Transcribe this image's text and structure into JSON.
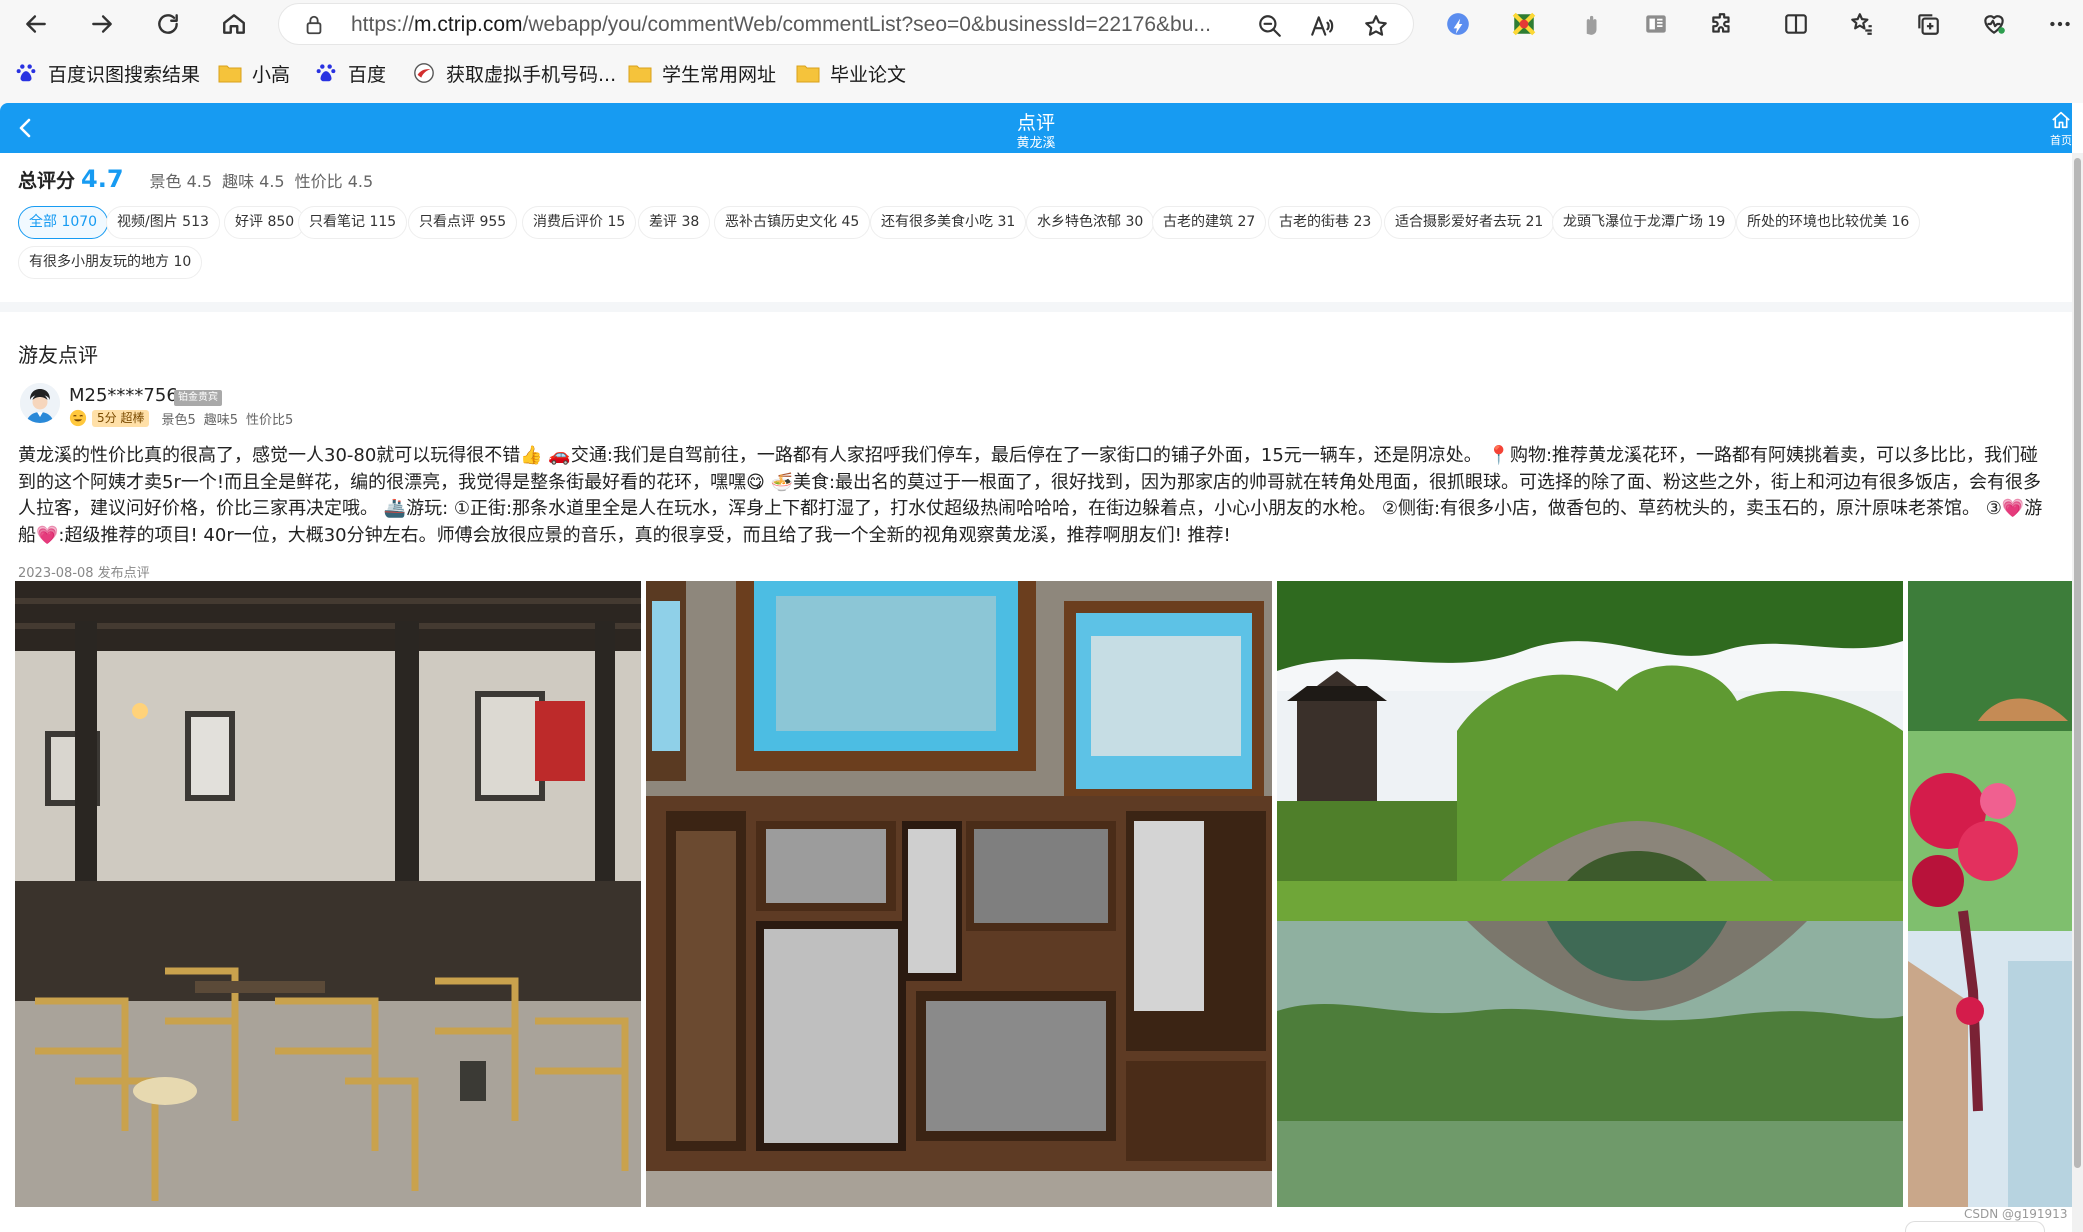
{
  "browser": {
    "url_prefix": "https://",
    "url_host": "m.ctrip.com",
    "url_path": "/webapp/you/commentWeb/commentList?seo=0&businessId=22176&bu..."
  },
  "bookmarks": [
    {
      "label": "百度识图搜索结果",
      "icon": "baidu-paw-icon"
    },
    {
      "label": "小高",
      "icon": "folder-icon"
    },
    {
      "label": "百度",
      "icon": "baidu-paw-icon"
    },
    {
      "label": "获取虚拟手机号码...",
      "icon": "site-icon"
    },
    {
      "label": "学生常用网址",
      "icon": "folder-icon"
    },
    {
      "label": "毕业论文",
      "icon": "folder-icon"
    }
  ],
  "header": {
    "title": "点评",
    "subtitle": "黄龙溪",
    "home_label": "首页",
    "accent": "#179bf2"
  },
  "score": {
    "label": "总评分",
    "value": "4.7",
    "scenery": "景色 4.5",
    "fun": "趣味 4.5",
    "value_for_money": "性价比 4.5"
  },
  "tags": [
    "全部 1070",
    "视频/图片 513",
    "好评 850",
    "只看笔记 115",
    "只看点评 955",
    "消费后评价 15",
    "差评 38",
    "恶补古镇历史文化 45",
    "还有很多美食小吃 31",
    "水乡特色浓郁 30",
    "古老的建筑 27",
    "古老的街巷 23",
    "适合摄影爱好者去玩 21",
    "龙頭飞瀑位于龙潭广场 19",
    "所处的环境也比较优美 16",
    "有很多小朋友玩的地方 10"
  ],
  "section": {
    "title": "游友点评"
  },
  "review": {
    "username": "M25****756",
    "badge": "铂金贵宾",
    "score_pill": "5分 超棒",
    "scenery": "景色5",
    "fun": "趣味5",
    "value_for_money": "性价比5",
    "text": "黄龙溪的性价比真的很高了，感觉一人30-80就可以玩得很不错👍 🚗交通:我们是自驾前往，一路都有人家招呼我们停车，最后停在了一家街口的铺子外面，15元一辆车，还是阴凉处。 📍购物:推荐黄龙溪花环，一路都有阿姨挑着卖，可以多比比，我们碰到的这个阿姨才卖5r一个!而且全是鲜花，编的很漂亮，我觉得是整条街最好看的花环，嘿嘿😋 🍜美食:最出名的莫过于一根面了，很好找到，因为那家店的帅哥就在转角处甩面，很抓眼球。可选择的除了面、粉这些之外，街上和河边有很多饭店，会有很多人拉客，建议问好价格，价比三家再决定哦。 🚢游玩: ①正街:那条水道里全是人在玩水，浑身上下都打湿了，打水仗超级热闹哈哈哈，在街边躲着点，小心小朋友的水枪。 ②侧街:有很多小店，做香包的、草药枕头的，卖玉石的，原汁原味老茶馆。 ③💗游船💗:超级推荐的项目! 40r一位，大概30分钟左右。师傅会放很应景的音乐，真的很享受，而且给了我一个全新的视角观察黄龙溪，推荐啊朋友们! 推荐!",
    "date": "2023-08-08 发布点评",
    "photos": [
      "teahouse-photo",
      "framed-photos-wall-photo",
      "stone-arch-bridge-photo",
      "flower-garland-photo"
    ]
  },
  "watermark": "CSDN @g191913"
}
